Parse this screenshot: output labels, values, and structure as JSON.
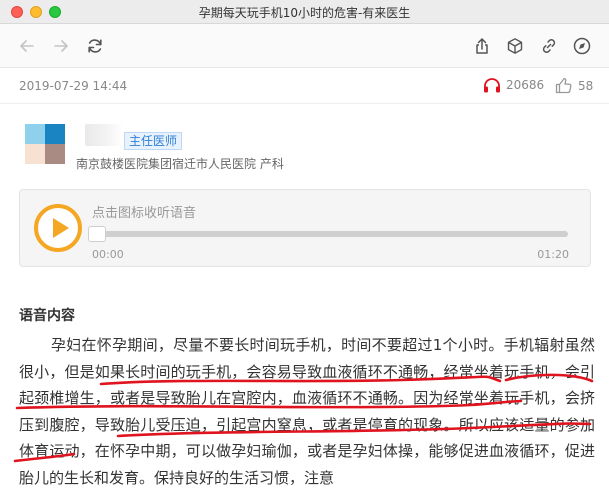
{
  "window": {
    "title": "孕期每天玩手机10小时的危害-有来医生"
  },
  "toolbar": {
    "back_icon": "arrow-left-icon",
    "forward_icon": "arrow-right-icon",
    "reload_icon": "reload-icon",
    "share_icon": "share-icon",
    "box_icon": "cube-icon",
    "link_icon": "link-icon",
    "compass_icon": "compass-icon"
  },
  "meta": {
    "date": "2019-07-29 14:44",
    "listens": "20686",
    "likes": "58"
  },
  "doctor": {
    "title_badge": "主任医师",
    "hospital": "南京鼓楼医院集团宿迁市人民医院 产科",
    "avatar_colors": [
      "#8fd0ec",
      "#1a84c2",
      "#f6e1d3",
      "#a98b83"
    ]
  },
  "audio": {
    "hint": "点击图标收听语音",
    "current_time": "00:00",
    "total_time": "01:20",
    "progress": 0,
    "accent_color": "#f5a623"
  },
  "content": {
    "section_title": "语音内容",
    "paragraph": "孕妇在怀孕期间，尽量不要长时间玩手机，时间不要超过1个小时。手机辐射虽然很小，但是如果长时间的玩手机，会容易导致血液循环不通畅，经常坐着玩手机，会引起颈椎增生，或者是导致胎儿在宫腔内，血液循环不通畅。因为经常坐着玩手机，会挤压到腹腔，导致胎儿受压迫，引起宫内窒息，或者是停育的现象。所以应该适量的参加体育运动，在怀孕中期，可以做孕妇瑜伽，或者是孕妇体操，能够促进血液循环，促进胎儿的生长和发育。保持良好的生活习惯，注意"
  },
  "annotation_color": "#e0141e"
}
